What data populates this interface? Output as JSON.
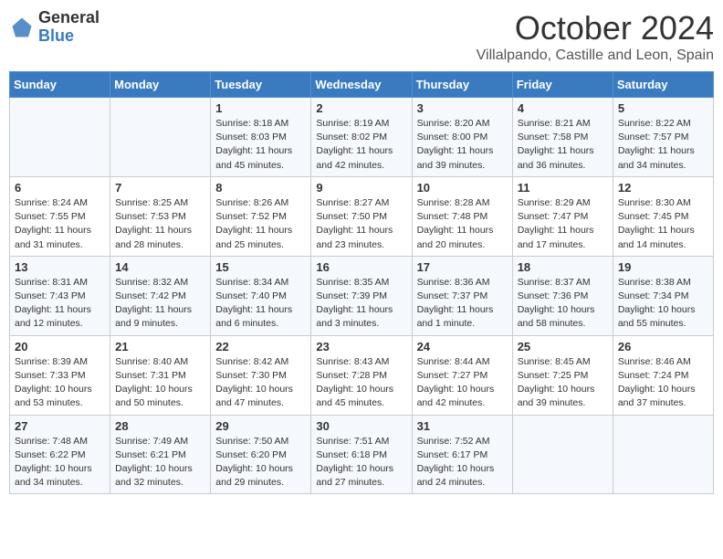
{
  "logo": {
    "general": "General",
    "blue": "Blue"
  },
  "title": "October 2024",
  "location": "Villalpando, Castille and Leon, Spain",
  "days_of_week": [
    "Sunday",
    "Monday",
    "Tuesday",
    "Wednesday",
    "Thursday",
    "Friday",
    "Saturday"
  ],
  "weeks": [
    [
      {
        "day": "",
        "info": ""
      },
      {
        "day": "",
        "info": ""
      },
      {
        "day": "1",
        "info": "Sunrise: 8:18 AM\nSunset: 8:03 PM\nDaylight: 11 hours and 45 minutes."
      },
      {
        "day": "2",
        "info": "Sunrise: 8:19 AM\nSunset: 8:02 PM\nDaylight: 11 hours and 42 minutes."
      },
      {
        "day": "3",
        "info": "Sunrise: 8:20 AM\nSunset: 8:00 PM\nDaylight: 11 hours and 39 minutes."
      },
      {
        "day": "4",
        "info": "Sunrise: 8:21 AM\nSunset: 7:58 PM\nDaylight: 11 hours and 36 minutes."
      },
      {
        "day": "5",
        "info": "Sunrise: 8:22 AM\nSunset: 7:57 PM\nDaylight: 11 hours and 34 minutes."
      }
    ],
    [
      {
        "day": "6",
        "info": "Sunrise: 8:24 AM\nSunset: 7:55 PM\nDaylight: 11 hours and 31 minutes."
      },
      {
        "day": "7",
        "info": "Sunrise: 8:25 AM\nSunset: 7:53 PM\nDaylight: 11 hours and 28 minutes."
      },
      {
        "day": "8",
        "info": "Sunrise: 8:26 AM\nSunset: 7:52 PM\nDaylight: 11 hours and 25 minutes."
      },
      {
        "day": "9",
        "info": "Sunrise: 8:27 AM\nSunset: 7:50 PM\nDaylight: 11 hours and 23 minutes."
      },
      {
        "day": "10",
        "info": "Sunrise: 8:28 AM\nSunset: 7:48 PM\nDaylight: 11 hours and 20 minutes."
      },
      {
        "day": "11",
        "info": "Sunrise: 8:29 AM\nSunset: 7:47 PM\nDaylight: 11 hours and 17 minutes."
      },
      {
        "day": "12",
        "info": "Sunrise: 8:30 AM\nSunset: 7:45 PM\nDaylight: 11 hours and 14 minutes."
      }
    ],
    [
      {
        "day": "13",
        "info": "Sunrise: 8:31 AM\nSunset: 7:43 PM\nDaylight: 11 hours and 12 minutes."
      },
      {
        "day": "14",
        "info": "Sunrise: 8:32 AM\nSunset: 7:42 PM\nDaylight: 11 hours and 9 minutes."
      },
      {
        "day": "15",
        "info": "Sunrise: 8:34 AM\nSunset: 7:40 PM\nDaylight: 11 hours and 6 minutes."
      },
      {
        "day": "16",
        "info": "Sunrise: 8:35 AM\nSunset: 7:39 PM\nDaylight: 11 hours and 3 minutes."
      },
      {
        "day": "17",
        "info": "Sunrise: 8:36 AM\nSunset: 7:37 PM\nDaylight: 11 hours and 1 minute."
      },
      {
        "day": "18",
        "info": "Sunrise: 8:37 AM\nSunset: 7:36 PM\nDaylight: 10 hours and 58 minutes."
      },
      {
        "day": "19",
        "info": "Sunrise: 8:38 AM\nSunset: 7:34 PM\nDaylight: 10 hours and 55 minutes."
      }
    ],
    [
      {
        "day": "20",
        "info": "Sunrise: 8:39 AM\nSunset: 7:33 PM\nDaylight: 10 hours and 53 minutes."
      },
      {
        "day": "21",
        "info": "Sunrise: 8:40 AM\nSunset: 7:31 PM\nDaylight: 10 hours and 50 minutes."
      },
      {
        "day": "22",
        "info": "Sunrise: 8:42 AM\nSunset: 7:30 PM\nDaylight: 10 hours and 47 minutes."
      },
      {
        "day": "23",
        "info": "Sunrise: 8:43 AM\nSunset: 7:28 PM\nDaylight: 10 hours and 45 minutes."
      },
      {
        "day": "24",
        "info": "Sunrise: 8:44 AM\nSunset: 7:27 PM\nDaylight: 10 hours and 42 minutes."
      },
      {
        "day": "25",
        "info": "Sunrise: 8:45 AM\nSunset: 7:25 PM\nDaylight: 10 hours and 39 minutes."
      },
      {
        "day": "26",
        "info": "Sunrise: 8:46 AM\nSunset: 7:24 PM\nDaylight: 10 hours and 37 minutes."
      }
    ],
    [
      {
        "day": "27",
        "info": "Sunrise: 7:48 AM\nSunset: 6:22 PM\nDaylight: 10 hours and 34 minutes."
      },
      {
        "day": "28",
        "info": "Sunrise: 7:49 AM\nSunset: 6:21 PM\nDaylight: 10 hours and 32 minutes."
      },
      {
        "day": "29",
        "info": "Sunrise: 7:50 AM\nSunset: 6:20 PM\nDaylight: 10 hours and 29 minutes."
      },
      {
        "day": "30",
        "info": "Sunrise: 7:51 AM\nSunset: 6:18 PM\nDaylight: 10 hours and 27 minutes."
      },
      {
        "day": "31",
        "info": "Sunrise: 7:52 AM\nSunset: 6:17 PM\nDaylight: 10 hours and 24 minutes."
      },
      {
        "day": "",
        "info": ""
      },
      {
        "day": "",
        "info": ""
      }
    ]
  ]
}
